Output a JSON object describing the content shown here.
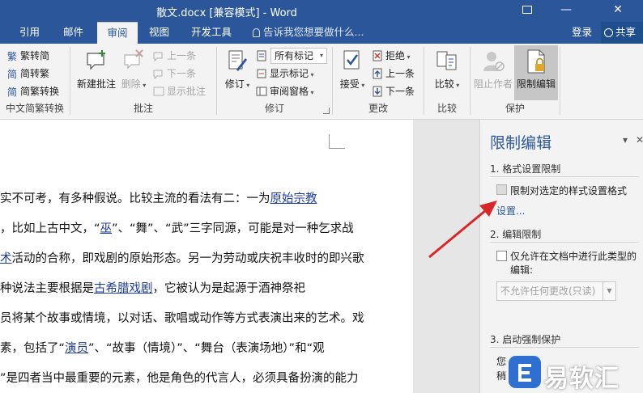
{
  "window": {
    "title": "散文.docx [兼容模式] - Word",
    "minimize": "—",
    "close": "✕"
  },
  "tabs": [
    {
      "label": "引用"
    },
    {
      "label": "邮件"
    },
    {
      "label": "审阅"
    },
    {
      "label": "视图"
    },
    {
      "label": "开发工具"
    }
  ],
  "tellme": "告诉我您想要做什么...",
  "account": {
    "login": "登录",
    "share": "共享"
  },
  "ribbon": {
    "groups": {
      "chinese": {
        "label": "中文简繁转换",
        "items": [
          "繁转简",
          "简转繁",
          "简繁转换"
        ]
      },
      "comments": {
        "label": "批注",
        "new_comment": "新建批注",
        "delete": "删除",
        "prev": "上一条",
        "next": "下一条",
        "show": "显示批注"
      },
      "tracking": {
        "label": "修订",
        "track": "修订",
        "markup_select": "所有标记",
        "show_markup": "显示标记",
        "review_pane": "审阅窗格"
      },
      "changes": {
        "label": "更改",
        "accept": "接受",
        "reject": "拒绝",
        "prev": "上一条",
        "next": "下一条"
      },
      "compare": {
        "label": "比较",
        "compare": "比较"
      },
      "protect": {
        "label": "保护",
        "block_authors": "阻止作者",
        "restrict_editing": "限制编辑"
      }
    }
  },
  "document": {
    "lines": [
      {
        "before": "实不可考，有多种假说。比较主流的看法有二：一为",
        "link": "原始宗教",
        "after": ""
      },
      {
        "before": "，比如上古中文，“",
        "link": "巫",
        "after": "”、“舞”、“武”三字同源，可能是对一种乞求战"
      },
      {
        "before": "",
        "link": "术",
        "after": "活动的合称，即戏剧的原始形态。另一为劳动或庆祝丰收时的即兴歌"
      },
      {
        "before": "种说法主要根据是",
        "link": "古希腊戏剧",
        "after": "，它被认为是起源于酒神祭祀"
      },
      {
        "before": "员将某个故事或情境，以对话、歌唱或动作等方式表演出来的艺术。戏",
        "link": "",
        "after": ""
      },
      {
        "before": "素，包括了“",
        "link": "演员",
        "after": "”、“故事（情境）”、“舞台（表演场地）”和“观"
      },
      {
        "before": "”是四者当中最重要的元素，他是角色的代言人，必须具备扮演的能力",
        "link": "",
        "after": ""
      }
    ]
  },
  "pane": {
    "title": "限制编辑",
    "section1": "1. 格式设置限制",
    "format_restrict": "限制对选定的样式设置格式",
    "settings_link": "设置...",
    "section2": "2. 编辑限制",
    "edit_restrict_line1": "仅允许在文档中进行此类型的",
    "edit_restrict_line2": "编辑:",
    "edit_select": "不允许任何更改(只读)",
    "section3": "3. 启动强制保护",
    "partial1": "您",
    "partial2": "稍"
  },
  "watermark": {
    "text": "易软汇"
  },
  "colors": {
    "accent": "#2b579a",
    "arrow": "#d9262b"
  }
}
